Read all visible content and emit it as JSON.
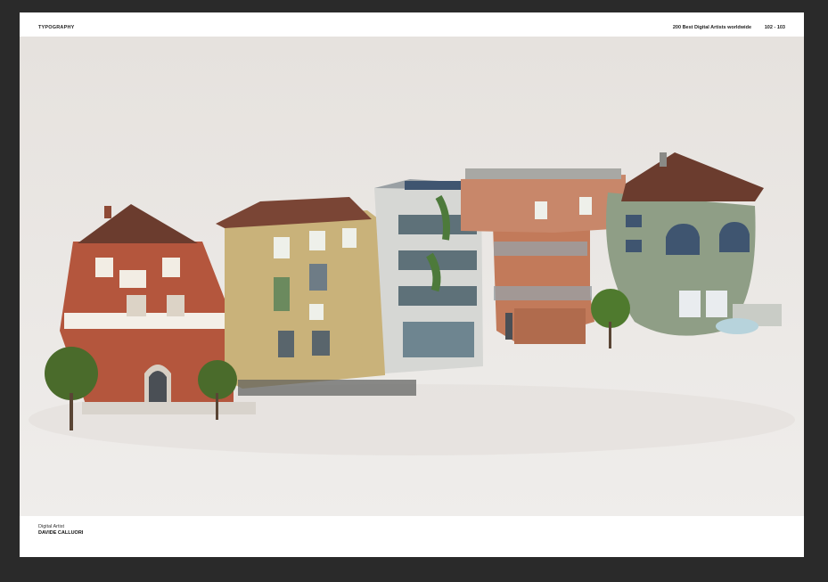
{
  "header": {
    "section": "TYPOGRAPHY",
    "book_title": "200 Best Digital Artists worldwide",
    "page_numbers": "102 - 103"
  },
  "credit": {
    "role": "Digital Artist",
    "name": "DAVIDE CALLUORI"
  },
  "colors": {
    "frame": "#2a2a2a",
    "page": "#ffffff",
    "artwork_background": "#e9e6e3",
    "brick": "#b4563d",
    "ochre": "#c9b27a",
    "sage": "#8f9e86",
    "roof": "#6b3c2e"
  }
}
